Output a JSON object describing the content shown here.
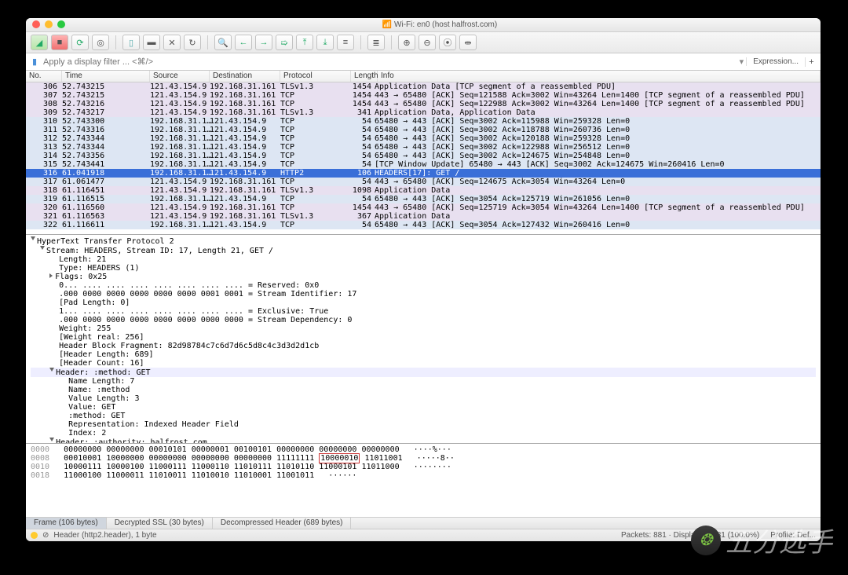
{
  "window": {
    "title": "Wi-Fi: en0 (host halfrost.com)"
  },
  "filter": {
    "placeholder": "Apply a display filter ... <⌘/>",
    "expression_label": "Expression...",
    "toggle_glyph": "▾"
  },
  "columns": {
    "no": "No.",
    "time": "Time",
    "source": "Source",
    "dest": "Destination",
    "proto": "Protocol",
    "len": "Length",
    "info": "Info"
  },
  "packets": [
    {
      "no": "306",
      "time": "52.743215",
      "src": "121.43.154.9",
      "dst": "192.168.31.161",
      "proto": "TLSv1.3",
      "len": "1454",
      "info": "Application Data [TCP segment of a reassembled PDU]",
      "cls": "pu"
    },
    {
      "no": "307",
      "time": "52.743215",
      "src": "121.43.154.9",
      "dst": "192.168.31.161",
      "proto": "TCP",
      "len": "1454",
      "info": "443 → 65480 [ACK] Seq=121588 Ack=3002 Win=43264 Len=1400 [TCP segment of a reassembled PDU]",
      "cls": "pu"
    },
    {
      "no": "308",
      "time": "52.743216",
      "src": "121.43.154.9",
      "dst": "192.168.31.161",
      "proto": "TCP",
      "len": "1454",
      "info": "443 → 65480 [ACK] Seq=122988 Ack=3002 Win=43264 Len=1400 [TCP segment of a reassembled PDU]",
      "cls": "pu"
    },
    {
      "no": "309",
      "time": "52.743217",
      "src": "121.43.154.9",
      "dst": "192.168.31.161",
      "proto": "TLSv1.3",
      "len": "341",
      "info": "Application Data, Application Data",
      "cls": "pu"
    },
    {
      "no": "310",
      "time": "52.743300",
      "src": "192.168.31.1…",
      "dst": "121.43.154.9",
      "proto": "TCP",
      "len": "54",
      "info": "65480 → 443 [ACK] Seq=3002 Ack=115988 Win=259328 Len=0",
      "cls": "bl"
    },
    {
      "no": "311",
      "time": "52.743316",
      "src": "192.168.31.1…",
      "dst": "121.43.154.9",
      "proto": "TCP",
      "len": "54",
      "info": "65480 → 443 [ACK] Seq=3002 Ack=118788 Win=260736 Len=0",
      "cls": "bl"
    },
    {
      "no": "312",
      "time": "52.743344",
      "src": "192.168.31.1…",
      "dst": "121.43.154.9",
      "proto": "TCP",
      "len": "54",
      "info": "65480 → 443 [ACK] Seq=3002 Ack=120188 Win=259328 Len=0",
      "cls": "bl"
    },
    {
      "no": "313",
      "time": "52.743344",
      "src": "192.168.31.1…",
      "dst": "121.43.154.9",
      "proto": "TCP",
      "len": "54",
      "info": "65480 → 443 [ACK] Seq=3002 Ack=122988 Win=256512 Len=0",
      "cls": "bl"
    },
    {
      "no": "314",
      "time": "52.743356",
      "src": "192.168.31.1…",
      "dst": "121.43.154.9",
      "proto": "TCP",
      "len": "54",
      "info": "65480 → 443 [ACK] Seq=3002 Ack=124675 Win=254848 Len=0",
      "cls": "bl"
    },
    {
      "no": "315",
      "time": "52.743441",
      "src": "192.168.31.1…",
      "dst": "121.43.154.9",
      "proto": "TCP",
      "len": "54",
      "info": "[TCP Window Update] 65480 → 443 [ACK] Seq=3002 Ack=124675 Win=260416 Len=0",
      "cls": "bl"
    },
    {
      "no": "316",
      "time": "61.041918",
      "src": "192.168.31.1…",
      "dst": "121.43.154.9",
      "proto": "HTTP2",
      "len": "106",
      "info": "HEADERS[17]: GET /",
      "cls": "sel"
    },
    {
      "no": "317",
      "time": "61.061477",
      "src": "121.43.154.9",
      "dst": "192.168.31.161",
      "proto": "TCP",
      "len": "54",
      "info": "443 → 65480 [ACK] Seq=124675 Ack=3054 Win=43264 Len=0",
      "cls": "bl"
    },
    {
      "no": "318",
      "time": "61.116451",
      "src": "121.43.154.9",
      "dst": "192.168.31.161",
      "proto": "TLSv1.3",
      "len": "1098",
      "info": "Application Data",
      "cls": "pu"
    },
    {
      "no": "319",
      "time": "61.116515",
      "src": "192.168.31.1…",
      "dst": "121.43.154.9",
      "proto": "TCP",
      "len": "54",
      "info": "65480 → 443 [ACK] Seq=3054 Ack=125719 Win=261056 Len=0",
      "cls": "bl"
    },
    {
      "no": "320",
      "time": "61.116560",
      "src": "121.43.154.9",
      "dst": "192.168.31.161",
      "proto": "TCP",
      "len": "1454",
      "info": "443 → 65480 [ACK] Seq=125719 Ack=3054 Win=43264 Len=1400 [TCP segment of a reassembled PDU]",
      "cls": "pu"
    },
    {
      "no": "321",
      "time": "61.116563",
      "src": "121.43.154.9",
      "dst": "192.168.31.161",
      "proto": "TLSv1.3",
      "len": "367",
      "info": "Application Data",
      "cls": "pu"
    },
    {
      "no": "322",
      "time": "61.116611",
      "src": "192.168.31.1…",
      "dst": "121.43.154.9",
      "proto": "TCP",
      "len": "54",
      "info": "65480 → 443 [ACK] Seq=3054 Ack=127432 Win=260416 Len=0",
      "cls": "bl"
    }
  ],
  "details": {
    "root": "HyperText Transfer Protocol 2",
    "stream": "Stream: HEADERS, Stream ID: 17, Length 21, GET /",
    "lines": [
      "Length: 21",
      "Type: HEADERS (1)",
      "Flags: 0x25",
      "0... .... .... .... .... .... .... .... = Reserved: 0x0",
      ".000 0000 0000 0000 0000 0000 0001 0001 = Stream Identifier: 17",
      "[Pad Length: 0]",
      "1... .... .... .... .... .... .... .... = Exclusive: True",
      ".000 0000 0000 0000 0000 0000 0000 0000 = Stream Dependency: 0",
      "Weight: 255",
      "[Weight real: 256]",
      "Header Block Fragment: 82d98784c7c6d7d6c5d8c4c3d3d2d1cb",
      "[Header Length: 689]",
      "[Header Count: 16]"
    ],
    "header1": "Header: :method: GET",
    "h1lines": [
      "Name Length: 7",
      "Name: :method",
      "Value Length: 3",
      "Value: GET",
      ":method: GET",
      "Representation: Indexed Header Field",
      "Index: 2"
    ],
    "header2": "Header: :authority: halfrost.com"
  },
  "hex": {
    "rows": [
      {
        "off": "0000",
        "b": "00000000 00000000 00010101 00000001 00100101 00000000 00000000",
        "b_hl": "",
        "tail": " 00000000",
        "asc": "····%···"
      },
      {
        "off": "0008",
        "b": "00010001 10000000 00000000 00000000 00000000 11111111 ",
        "b_hl": "10000010",
        "tail": " 11011001",
        "asc": "·····8··"
      },
      {
        "off": "0010",
        "b": "10000111 10000100 11000111 11000110 11010111 11010110 11000101 11011000",
        "b_hl": "",
        "tail": "",
        "asc": "········"
      },
      {
        "off": "0018",
        "b": "11000100 11000011 11010011 11010010 11010001 11001011",
        "b_hl": "",
        "tail": "",
        "asc": "······"
      }
    ]
  },
  "tabs": [
    {
      "label": "Frame (106 bytes)",
      "active": true,
      "name": "tab-frame"
    },
    {
      "label": "Decrypted SSL (30 bytes)",
      "active": false,
      "name": "tab-decrypted-ssl"
    },
    {
      "label": "Decompressed Header (689 bytes)",
      "active": false,
      "name": "tab-decompressed-header"
    }
  ],
  "status": {
    "context": "Header (http2.header), 1 byte",
    "packets": "Packets: 881 · Displayed: 881 (100.0%)",
    "profile": "Profile: Def..."
  },
  "toolbar_icons": [
    "fin-icon",
    "stop-icon",
    "restart-icon",
    "options-icon",
    "open-icon",
    "save-icon",
    "close-icon",
    "reload-icon",
    "find-icon",
    "back-icon",
    "fwd-icon",
    "jump-icon",
    "top-icon",
    "bottom-icon",
    "auto-icon",
    "colorize-icon",
    "zoom-in-icon",
    "zoom-out-icon",
    "zoom-reset-icon",
    "resize-icon"
  ],
  "watermark": "五分选手"
}
